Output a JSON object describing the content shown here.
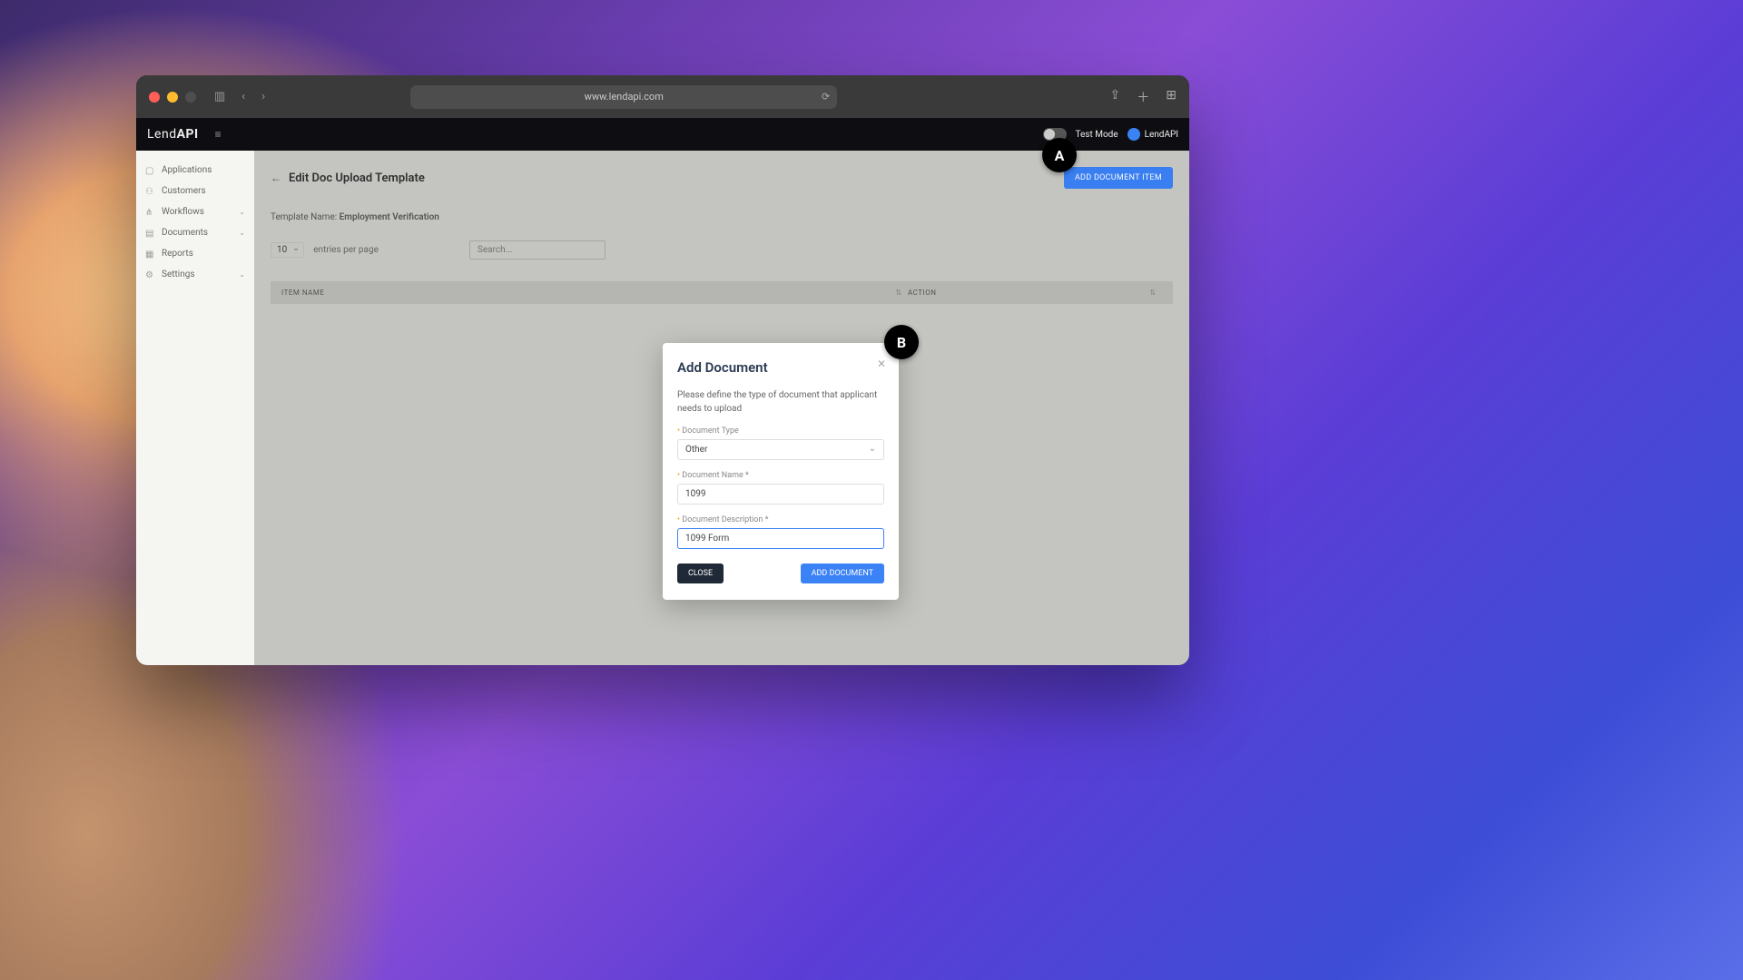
{
  "browser": {
    "url": "www.lendapi.com"
  },
  "appbar": {
    "brand_prefix": "Lend",
    "brand_suffix": "API",
    "test_mode_label": "Test Mode",
    "user_label": "LendAPI"
  },
  "sidebar": {
    "items": [
      {
        "label": "Applications",
        "icon": "apps"
      },
      {
        "label": "Customers",
        "icon": "users"
      },
      {
        "label": "Workflows",
        "icon": "flow",
        "expandable": true
      },
      {
        "label": "Documents",
        "icon": "doc",
        "expandable": true
      },
      {
        "label": "Reports",
        "icon": "report"
      },
      {
        "label": "Settings",
        "icon": "gear",
        "expandable": true
      }
    ]
  },
  "page": {
    "title": "Edit Doc Upload Template",
    "add_button": "ADD DOCUMENT ITEM",
    "template_name_label": "Template Name:",
    "template_name_value": "Employment Verification",
    "entries_value": "10",
    "entries_label": "entries per page",
    "search_placeholder": "Search...",
    "columns": {
      "name": "ITEM NAME",
      "action": "ACTION"
    }
  },
  "modal": {
    "title": "Add Document",
    "description": "Please define the type of document that applicant needs to upload",
    "doc_type_label": "Document Type",
    "doc_type_value": "Other",
    "doc_name_label": "Document Name *",
    "doc_name_value": "1099",
    "doc_desc_label": "Document Description *",
    "doc_desc_value": "1099 Form",
    "close_btn": "CLOSE",
    "submit_btn": "ADD DOCUMENT"
  },
  "markers": {
    "a": "A",
    "b": "B"
  }
}
